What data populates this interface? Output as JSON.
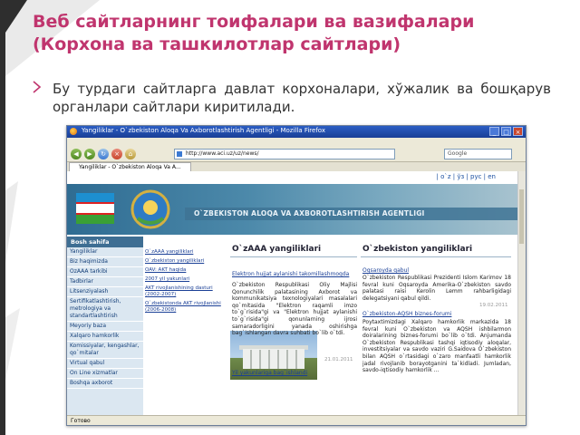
{
  "slide": {
    "title": "Веб сайтларнинг тоифалари ва вазифалари (Корхона ва ташкилотлар сайтлари)",
    "bullet": "Бу турдаги сайтларга давлат корхоналари, хўжалик ва бошқарув органлари сайтлари киритилади.",
    "accent_color": "#c0356e"
  },
  "browser": {
    "window_title": "Yangiliklar - O`zbekiston Aloqa Va Axborotlashtirish Agentligi - Mozilla Firefox",
    "url": "http://www.aci.uz/uz/news/",
    "search_placeholder": "Google",
    "tab_label": "Yangiliklar - O`zbekiston Aloqa Va A...",
    "status": "Готово"
  },
  "site": {
    "lang_links": "| o`z | ўз | рус | en",
    "agency_name": "O`ZBEKISTON ALOQA VA AXBOROTLASHTIRISH AGENTLIGI",
    "nav_header": "Bosh sahifa",
    "nav_items": [
      "Yangiliklar",
      "Biz haqimizda",
      "OzAAA tarkibi",
      "Tadbirlar",
      "Litsenziyalash",
      "Sertifikatlashtirish, metrologiya va standartlashtirish",
      "Meyoriy baza",
      "Xalqaro hamkorlik",
      "Komissiyalar, kengashlar, qo`mitalar",
      "Virtual qabul",
      "On Line xizmatlar",
      "Boshqa axborot"
    ],
    "sub_items": [
      "O`zAAA yangiliklari",
      "O`zbekiston yangiliklari",
      "OAV: AKT haqida",
      "2007 yil yakunlari",
      "AKT rivojlanishining dasturi (2002-2007)",
      "O`zbekistonda AKT rivojlanishi (2006-2008)"
    ],
    "col1": {
      "title": "O`zAAA yangiliklari",
      "news1_title": "Elektron hujjat aylanishi takomillashmoqda",
      "news1_text": "O`zbekiston Respublikasi Oliy Majlisi Qonunchilik palatasining Axborot va kommunikatsiya texnologiyalari masalalari qo`mitasida \"Elektron raqamli imzo to`g`risida\"gi va \"Elektron hujjat aylanishi to`g`risida\"gi qonunlarning ijrosi samaradorligini yanada oshirishga bag`ishlangan davra suhbati bo`lib o`tdi.",
      "news1_date": "21.01.2011",
      "news2_title": "Yil yakunlariga bag`ishlandi"
    },
    "col2": {
      "title": "O`zbekiston yangiliklari",
      "news1_title": "Oqsaroyda qabul",
      "news1_text": "O`zbekiston Respublikasi Prezidenti Islom Karimov 18 fevral kuni Oqsaroyda Amerika-O`zbekiston savdo palatasi raisi Kerolin Lemm rahbarligidagi delegatsiyani qabul qildi.",
      "news1_date": "19.02.2011",
      "news2_title": "O`zbekiston-AQSH biznes-forumi",
      "news2_text": "Poytaxtimizdagi Xalqaro hamkorlik markazida 18 fevral kuni O`zbekiston va AQSH ishbilarmon doiralarining biznes-forumi bo`lib o`tdi. Anjumanda O`zbekiston Respublikasi tashqi iqtisodiy aloqalar, investitsiyalar va savdo vaziri G.Saidova O`zbekiston bilan AQSH o`rtasidagi o`zaro manfaatli hamkorlik jadal rivojlanib borayotganini ta`kidladi. Jumladan, savdo-iqtisodiy hamkorlik ..."
    }
  }
}
